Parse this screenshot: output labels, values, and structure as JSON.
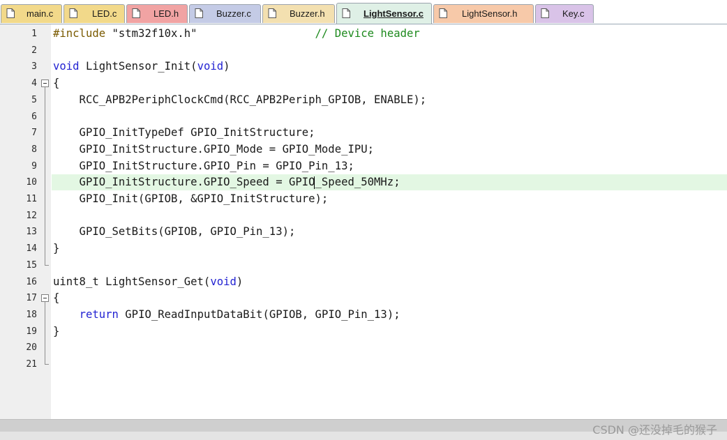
{
  "tabs": [
    {
      "label": "main.c",
      "color": "#f2d98a",
      "icon": "document-icon"
    },
    {
      "label": "LED.c",
      "color": "#f2d98a",
      "icon": "document-icon"
    },
    {
      "label": "LED.h",
      "color": "#f1a3a3",
      "icon": "document-icon"
    },
    {
      "label": "Buzzer.c",
      "color": "#c4cbe6",
      "icon": "document-icon"
    },
    {
      "label": "Buzzer.h",
      "color": "#f3e0b0",
      "icon": "document-icon"
    },
    {
      "label": "LightSensor.c",
      "color": "#b9dcc9",
      "icon": "document-icon",
      "active": true
    },
    {
      "label": "LightSensor.h",
      "color": "#f7c9a9",
      "icon": "document-icon"
    },
    {
      "label": "Key.c",
      "color": "#d9c3e8",
      "icon": "document-icon"
    }
  ],
  "editor": {
    "current_line": 10,
    "lines": [
      {
        "n": "1",
        "segs": [
          [
            "pp",
            "#include"
          ],
          [
            "str",
            " \"stm32f10x.h\""
          ],
          [
            "t",
            "                  "
          ],
          [
            "cm",
            "// Device header"
          ]
        ]
      },
      {
        "n": "2",
        "segs": []
      },
      {
        "n": "3",
        "segs": [
          [
            "kw",
            "void"
          ],
          [
            "t",
            " LightSensor_Init("
          ],
          [
            "kw",
            "void"
          ],
          [
            "t",
            ")"
          ]
        ]
      },
      {
        "n": "4",
        "segs": [
          [
            "t",
            "{"
          ]
        ]
      },
      {
        "n": "5",
        "segs": [
          [
            "t",
            "    RCC_APB2PeriphClockCmd(RCC_APB2Periph_GPIOB, ENABLE);"
          ]
        ]
      },
      {
        "n": "6",
        "segs": []
      },
      {
        "n": "7",
        "segs": [
          [
            "t",
            "    GPIO_InitTypeDef GPIO_InitStructure;"
          ]
        ]
      },
      {
        "n": "8",
        "segs": [
          [
            "t",
            "    GPIO_InitStructure.GPIO_Mode = GPIO_Mode_IPU;"
          ]
        ]
      },
      {
        "n": "9",
        "segs": [
          [
            "t",
            "    GPIO_InitStructure.GPIO_Pin = GPIO_Pin_13;"
          ]
        ]
      },
      {
        "n": "10",
        "segs": [
          [
            "t",
            "    GPIO_InitStructure.GPIO_Speed = GPIO_Speed_50MHz;"
          ]
        ]
      },
      {
        "n": "11",
        "segs": [
          [
            "t",
            "    GPIO_Init(GPIOB, &GPIO_InitStructure);"
          ]
        ]
      },
      {
        "n": "12",
        "segs": []
      },
      {
        "n": "13",
        "segs": [
          [
            "t",
            "    GPIO_SetBits(GPIOB, GPIO_Pin_13);"
          ]
        ]
      },
      {
        "n": "14",
        "segs": [
          [
            "t",
            "}"
          ]
        ]
      },
      {
        "n": "15",
        "segs": []
      },
      {
        "n": "16",
        "segs": [
          [
            "t",
            "uint8_t LightSensor_Get("
          ],
          [
            "kw",
            "void"
          ],
          [
            "t",
            ")"
          ]
        ]
      },
      {
        "n": "17",
        "segs": [
          [
            "t",
            "{"
          ]
        ]
      },
      {
        "n": "18",
        "segs": [
          [
            "t",
            "    "
          ],
          [
            "kw",
            "return"
          ],
          [
            "t",
            " GPIO_ReadInputDataBit(GPIOB, GPIO_Pin_13);"
          ]
        ]
      },
      {
        "n": "19",
        "segs": [
          [
            "t",
            "}"
          ]
        ]
      },
      {
        "n": "20",
        "segs": []
      },
      {
        "n": "21",
        "segs": []
      }
    ]
  },
  "watermark": "CSDN @还没掉毛的猴子",
  "colors": {
    "keyword": "#2323d2",
    "comment": "#1e8a1e",
    "preprocessor": "#7a5a00",
    "current_line": "#e3f7e3"
  }
}
